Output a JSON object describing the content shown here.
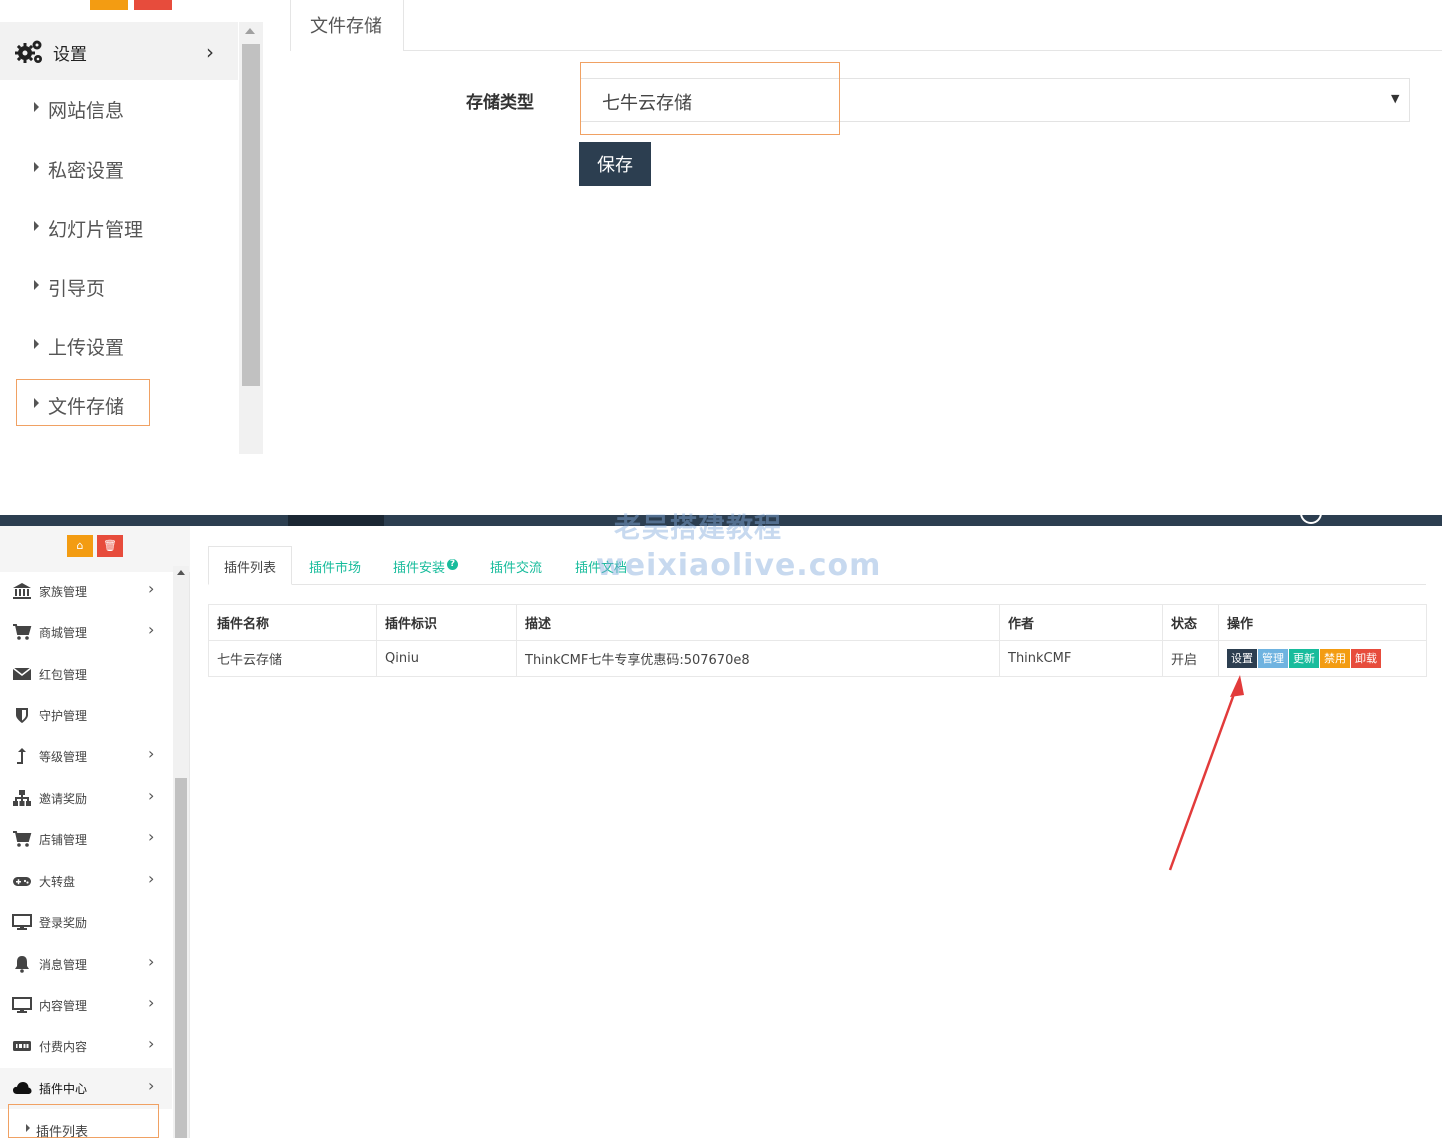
{
  "top_panel": {
    "sidebar": {
      "settings_label": "设置",
      "items": [
        {
          "label": "网站信息"
        },
        {
          "label": "私密设置"
        },
        {
          "label": "幻灯片管理"
        },
        {
          "label": "引导页"
        },
        {
          "label": "上传设置"
        },
        {
          "label": "文件存储"
        }
      ]
    },
    "tab_label": "文件存储",
    "form": {
      "storage_type_label": "存储类型",
      "storage_type_value": "七牛云存储",
      "save_label": "保存"
    }
  },
  "bottom_panel": {
    "sidebar": {
      "items": [
        {
          "label": "家族管理",
          "icon": "bank-icon",
          "chevron": true
        },
        {
          "label": "商城管理",
          "icon": "cart-icon",
          "chevron": true
        },
        {
          "label": "红包管理",
          "icon": "envelope-icon",
          "chevron": false
        },
        {
          "label": "守护管理",
          "icon": "shield-icon",
          "chevron": false
        },
        {
          "label": "等级管理",
          "icon": "level-up-icon",
          "chevron": true
        },
        {
          "label": "邀请奖励",
          "icon": "sitemap-icon",
          "chevron": true
        },
        {
          "label": "店铺管理",
          "icon": "cart-icon",
          "chevron": true
        },
        {
          "label": "大转盘",
          "icon": "gamepad-icon",
          "chevron": true
        },
        {
          "label": "登录奖励",
          "icon": "monitor-icon",
          "chevron": false
        },
        {
          "label": "消息管理",
          "icon": "bell-icon",
          "chevron": true
        },
        {
          "label": "内容管理",
          "icon": "monitor-icon",
          "chevron": true
        },
        {
          "label": "付费内容",
          "icon": "imdb-icon",
          "chevron": true
        },
        {
          "label": "插件中心",
          "icon": "cloud-icon",
          "chevron": true
        }
      ],
      "sub_item": "插件列表"
    },
    "tabs": [
      {
        "label": "插件列表"
      },
      {
        "label": "插件市场"
      },
      {
        "label": "插件安装"
      },
      {
        "label": "插件交流"
      },
      {
        "label": "插件文档"
      }
    ],
    "table": {
      "headers": [
        "插件名称",
        "插件标识",
        "描述",
        "作者",
        "状态",
        "操作"
      ],
      "rows": [
        {
          "name": "七牛云存储",
          "id": "Qiniu",
          "desc": "ThinkCMF七牛专享优惠码:507670e8",
          "author": "ThinkCMF",
          "status": "开启",
          "actions": [
            "设置",
            "管理",
            "更新",
            "禁用",
            "卸载"
          ]
        }
      ]
    },
    "colors": {
      "dark": "#2c3e50",
      "info": "#6fb3e0",
      "success": "#18bc9c",
      "warning": "#f39c12",
      "danger": "#e74c3c"
    }
  },
  "watermark": {
    "line1": "老吴搭建教程",
    "line2": "weixiaolive.com"
  }
}
